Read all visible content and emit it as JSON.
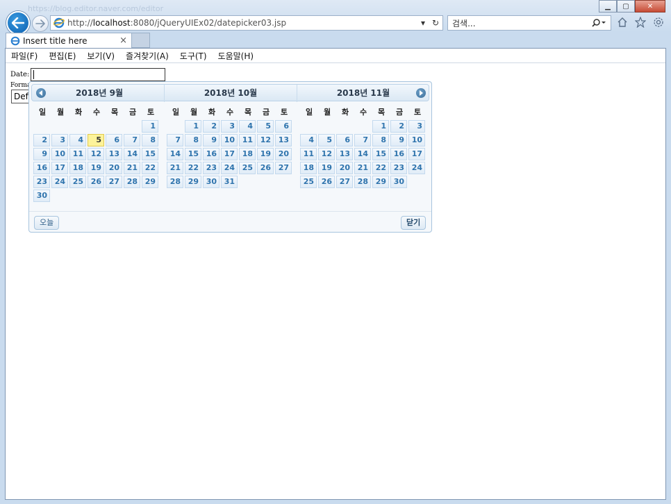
{
  "browser": {
    "blurred_title": "https://blog.editor.naver.com/editor",
    "url_prefix": "http://",
    "url_host": "localhost",
    "url_rest": ":8080/jQueryUIEx02/datepicker03.jsp",
    "search_placeholder": "검색...",
    "tab_title": "Insert title here",
    "tab_close": "×"
  },
  "menu": [
    "파일(F)",
    "편집(E)",
    "보기(V)",
    "즐겨찾기(A)",
    "도구(T)",
    "도움말(H)"
  ],
  "form": {
    "date_label": "Date:",
    "format_label": "Forma",
    "format_value": "Defa"
  },
  "datepicker": {
    "weekdays": [
      "일",
      "월",
      "화",
      "수",
      "목",
      "금",
      "토"
    ],
    "months": [
      {
        "title": "2018년 9월",
        "weeks": [
          [
            "",
            "",
            "",
            "",
            "",
            "",
            "1"
          ],
          [
            "2",
            "3",
            "4",
            "5",
            "6",
            "7",
            "8"
          ],
          [
            "9",
            "10",
            "11",
            "12",
            "13",
            "14",
            "15"
          ],
          [
            "16",
            "17",
            "18",
            "19",
            "20",
            "21",
            "22"
          ],
          [
            "23",
            "24",
            "25",
            "26",
            "27",
            "28",
            "29"
          ],
          [
            "30",
            "",
            "",
            "",
            "",
            "",
            ""
          ]
        ],
        "today": "5"
      },
      {
        "title": "2018년 10월",
        "weeks": [
          [
            "",
            "1",
            "2",
            "3",
            "4",
            "5",
            "6"
          ],
          [
            "7",
            "8",
            "9",
            "10",
            "11",
            "12",
            "13"
          ],
          [
            "14",
            "15",
            "16",
            "17",
            "18",
            "19",
            "20"
          ],
          [
            "21",
            "22",
            "23",
            "24",
            "25",
            "26",
            "27"
          ],
          [
            "28",
            "29",
            "30",
            "31",
            "",
            "",
            ""
          ]
        ]
      },
      {
        "title": "2018년 11월",
        "weeks": [
          [
            "",
            "",
            "",
            "",
            "1",
            "2",
            "3"
          ],
          [
            "4",
            "5",
            "6",
            "7",
            "8",
            "9",
            "10"
          ],
          [
            "11",
            "12",
            "13",
            "14",
            "15",
            "16",
            "17"
          ],
          [
            "18",
            "19",
            "20",
            "21",
            "22",
            "23",
            "24"
          ],
          [
            "25",
            "26",
            "27",
            "28",
            "29",
            "30",
            ""
          ]
        ]
      }
    ],
    "today_button": "오늘",
    "close_button": "닫기",
    "colors": {
      "today_highlight": "#fdf39a",
      "day_text": "#2f74ad"
    }
  }
}
